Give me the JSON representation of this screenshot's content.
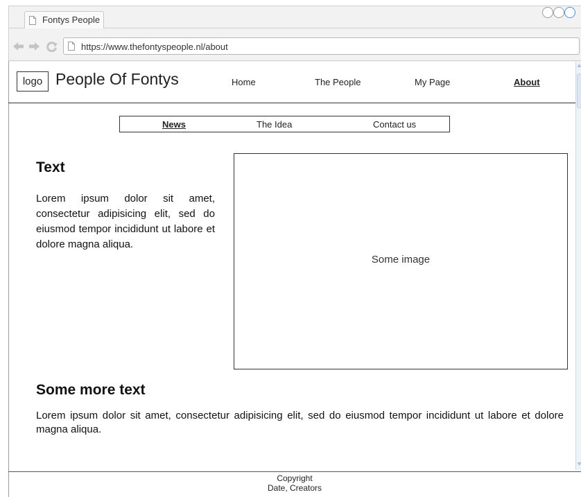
{
  "browser": {
    "tab_title": "Fontys People",
    "url": "https://www.thefontyspeople.nl/about"
  },
  "header": {
    "logo_label": "logo",
    "site_title": "People Of Fontys",
    "nav": [
      {
        "label": "Home"
      },
      {
        "label": "The People"
      },
      {
        "label": "My Page"
      },
      {
        "label": "About",
        "active": true
      }
    ]
  },
  "subnav": {
    "items": [
      {
        "label": "News",
        "active": true
      },
      {
        "label": "The Idea"
      },
      {
        "label": "Contact us"
      }
    ]
  },
  "content": {
    "section1_heading": "Text",
    "section1_body": "Lorem ipsum dolor sit amet, consectetur adipisicing elit, sed do eiusmod tempor incididunt ut labore et dolore magna aliqua.",
    "image_label": "Some image",
    "section2_heading": "Some more text",
    "section2_body": "Lorem ipsum dolor sit amet, consectetur adipisicing elit, sed do eiusmod tempor incididunt ut labore et dolore magna aliqua."
  },
  "footer": {
    "line1": "Copyright",
    "line2": "Date, Creators"
  },
  "colors": {
    "chrome_bg": "#f2f2f2",
    "border": "#333333",
    "window_circle_accent": "#4a90d9"
  }
}
